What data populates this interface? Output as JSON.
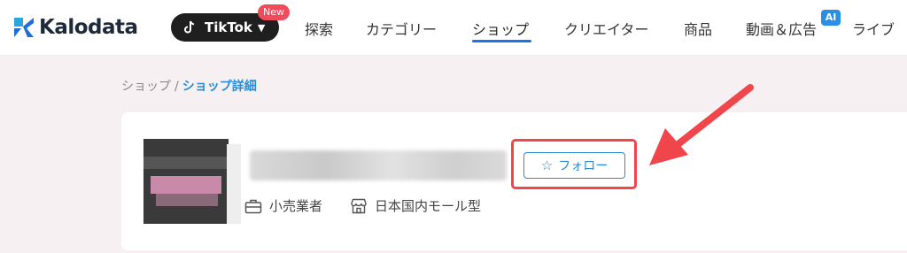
{
  "brand": {
    "name": "Kalodata"
  },
  "platform": {
    "label": "TikTok",
    "badge": "New"
  },
  "nav": {
    "items": [
      {
        "label": "探索"
      },
      {
        "label": "カテゴリー"
      },
      {
        "label": "ショップ",
        "active": true
      },
      {
        "label": "クリエイター"
      },
      {
        "label": "商品"
      },
      {
        "label": "動画＆広告"
      },
      {
        "label": "ライブ"
      }
    ],
    "ai_badge": "AI"
  },
  "breadcrumb": {
    "parent": "ショップ",
    "separator": "/",
    "current": "ショップ詳細"
  },
  "shop": {
    "tags": [
      {
        "icon": "briefcase-icon",
        "label": "小売業者"
      },
      {
        "icon": "storefront-icon",
        "label": "日本国内モール型"
      }
    ],
    "follow_label": "フォロー"
  },
  "colors": {
    "accent": "#2a8bd6",
    "highlight": "#f0454a",
    "tiktok_bg": "#1f1f1f",
    "badge": "#ef4b5a"
  }
}
